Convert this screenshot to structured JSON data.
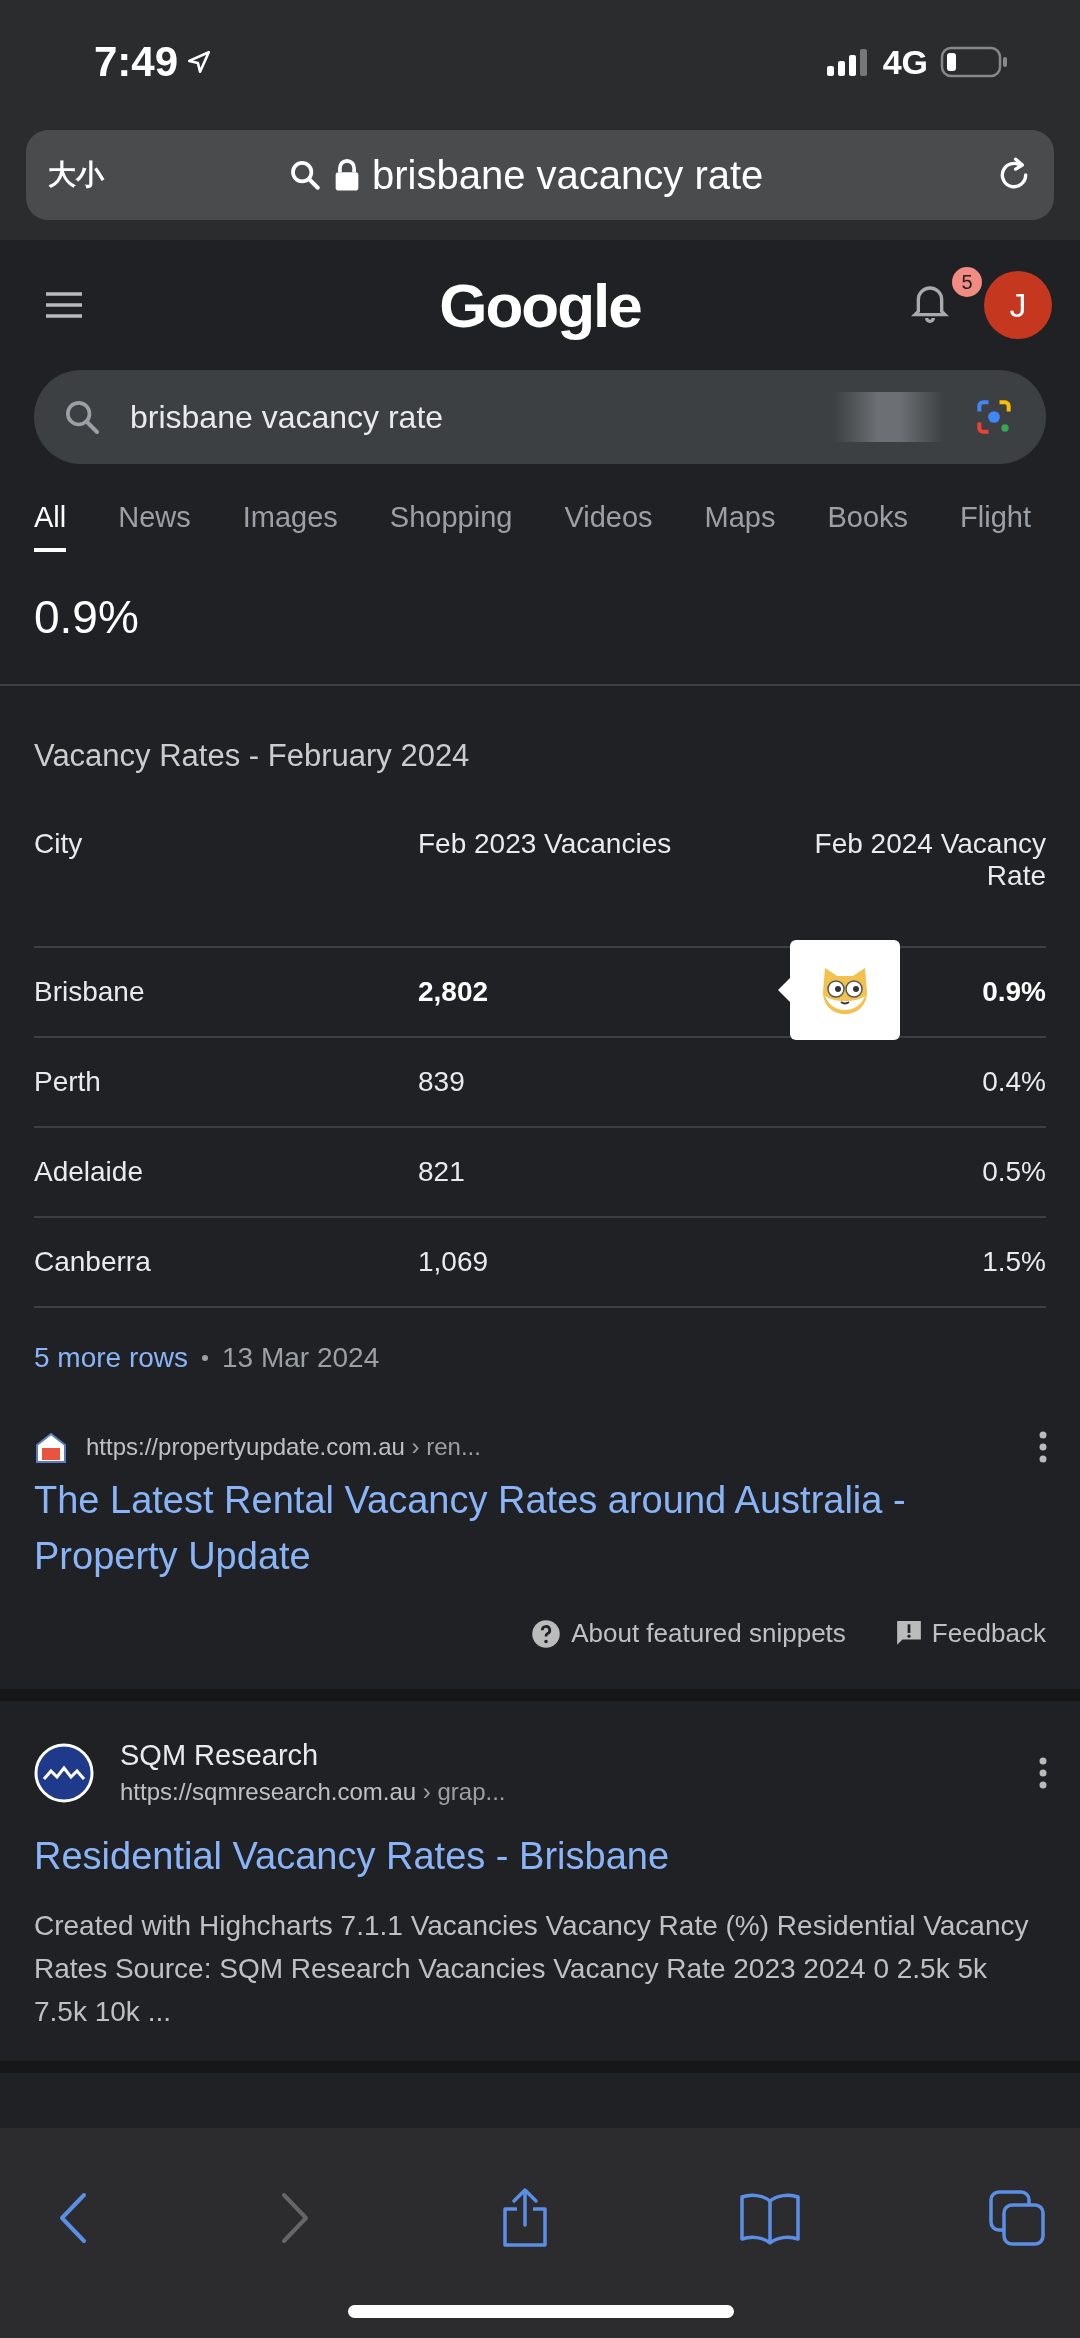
{
  "status_bar": {
    "time": "7:49",
    "network": "4G"
  },
  "address_bar": {
    "text_size_button": "大小",
    "url": "brisbane vacancy rate"
  },
  "header": {
    "logo": "Google",
    "notification_count": "5",
    "avatar_letter": "J"
  },
  "search": {
    "value": "brisbane vacancy rate"
  },
  "tabs": [
    {
      "label": "All",
      "selected": true
    },
    {
      "label": "News",
      "selected": false
    },
    {
      "label": "Images",
      "selected": false
    },
    {
      "label": "Shopping",
      "selected": false
    },
    {
      "label": "Videos",
      "selected": false
    },
    {
      "label": "Maps",
      "selected": false
    },
    {
      "label": "Books",
      "selected": false
    },
    {
      "label": "Flight",
      "selected": false
    }
  ],
  "featured_snippet": {
    "answer": "0.9%",
    "table_title": "Vacancy Rates - February 2024",
    "columns": [
      "City",
      "Feb 2023 Vacancies",
      "Feb 2024 Vacancy Rate"
    ],
    "rows": [
      {
        "cells": [
          "Brisbane",
          "2,802",
          "0.9%"
        ],
        "highlighted": true
      },
      {
        "cells": [
          "Perth",
          "839",
          "0.4%"
        ],
        "highlighted": false
      },
      {
        "cells": [
          "Adelaide",
          "821",
          "0.5%"
        ],
        "highlighted": false
      },
      {
        "cells": [
          "Canberra",
          "1,069",
          "1.5%"
        ],
        "highlighted": false
      }
    ],
    "more_rows": "5 more rows",
    "date": "13 Mar 2024",
    "source_url": "https://propertyupdate.com.au",
    "source_path": "› ren...",
    "source_title": "The Latest Rental Vacancy Rates around Australia - Property Update",
    "about": "About featured snippets",
    "feedback": "Feedback"
  },
  "result": {
    "site": "SQM Research",
    "url": "https://sqmresearch.com.au",
    "path": "› grap...",
    "title": "Residential Vacancy Rates - Brisbane",
    "snippet": "Created with Highcharts 7.1.1 Vacancies Vacancy Rate (%) Residential Vacancy Rates Source: SQM Research Vacancies Vacancy Rate 2023 2024 0 2.5k 5k 7.5k 10k ..."
  }
}
